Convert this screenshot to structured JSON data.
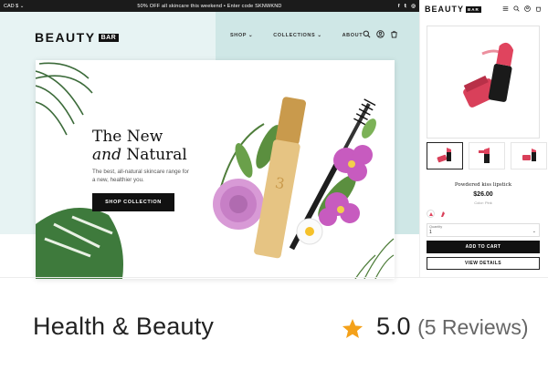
{
  "desktop": {
    "topbar": {
      "currency": "CAD $ ⌄",
      "promo": "50% OFF all skincare this weekend • Enter code SKNWKND",
      "social": [
        "f",
        "🐦",
        "◎"
      ]
    },
    "logo": {
      "text": "BEAUTY",
      "badge": "BAR"
    },
    "menu": [
      "SHOP ⌄",
      "COLLECTIONS ⌄",
      "ABOUT"
    ],
    "nav_icons": [
      "search-icon",
      "account-icon",
      "cart-icon"
    ],
    "hero": {
      "headline_line1": "The New",
      "headline_line2_italic": "and",
      "headline_line2_rest": " Natural",
      "subtext": "The best, all-natural skincare range for a new, healthier you.",
      "cta": "SHOP COLLECTION"
    }
  },
  "mobile": {
    "logo": {
      "text": "BEAUTY",
      "badge": "BAR"
    },
    "icons": [
      "menu-icon",
      "search-icon",
      "account-icon",
      "cart-icon"
    ],
    "product": {
      "title": "Powdered kiss lipstick",
      "price": "$26.00",
      "color": "Color: Pink",
      "quantity_label": "Quantity",
      "quantity_value": "1",
      "add_to_cart": "ADD TO CART",
      "view_details": "VIEW DETAILS"
    }
  },
  "footer": {
    "category": "Health & Beauty",
    "rating": "5.0",
    "reviews": "(5 Reviews)",
    "star_color": "#f4a11a"
  },
  "colors": {
    "hero_left": "#e7f3f3",
    "hero_right": "#cfe7e6",
    "lipstick": "#e0445e",
    "tube_gold": "#d9b26a"
  }
}
